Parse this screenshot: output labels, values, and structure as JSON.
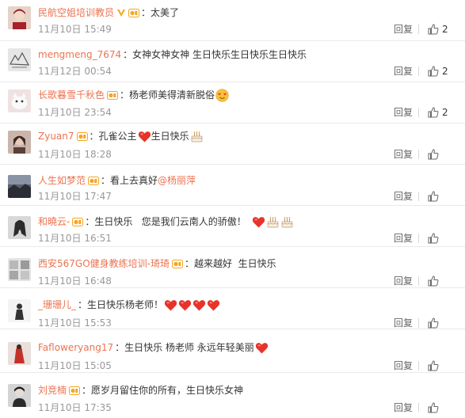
{
  "comments": [
    {
      "username": "民航空姐培训教员",
      "verified": true,
      "text": "太美了",
      "emoji": [],
      "time": "11月10日 15:49",
      "reply": "回复",
      "likes": "2",
      "avatar_bg": "#e7d2c8"
    },
    {
      "username": "mengmeng_7674",
      "verified": false,
      "badge": false,
      "text": "女神女神女神 生日快乐生日快乐生日快乐",
      "emoji": [],
      "time": "11月12日 00:54",
      "reply": "回复",
      "likes": "2",
      "avatar_bg": "#dcdcdc"
    },
    {
      "username": "长歌暮雪千秋色",
      "verified": false,
      "text": "杨老师美得清新脱俗",
      "emoji": [
        "love-face"
      ],
      "time": "11月10日 23:54",
      "reply": "回复",
      "likes": "2",
      "avatar_bg": "#f0dcdc"
    },
    {
      "username": "Zyuan7",
      "verified": false,
      "text": "孔雀公主",
      "text2": "生日快乐",
      "emoji": [
        "heart"
      ],
      "emoji2": [
        "cake"
      ],
      "time": "11月10日 18:28",
      "reply": "回复",
      "likes": "",
      "avatar_bg": "#b8a39a"
    },
    {
      "username": "人生如梦范",
      "verified": false,
      "text": "看上去真好",
      "mention": "@杨丽萍",
      "emoji": [],
      "time": "11月10日 17:47",
      "reply": "回复",
      "likes": "",
      "avatar_bg": "#4a4e56"
    },
    {
      "username": "和曉云-",
      "verified": false,
      "text": "生日快乐   您是我们云南人的骄傲！",
      "emoji": [
        "heart",
        "cake",
        "cake"
      ],
      "time": "11月10日 16:51",
      "reply": "回复",
      "likes": "",
      "avatar_bg": "#cfcfcf"
    },
    {
      "username": "西安567GO健身教练培训-琦琦",
      "verified": false,
      "text": "越来越好  生日快乐",
      "emoji": [],
      "time": "11月10日 16:48",
      "reply": "回复",
      "likes": "",
      "avatar_bg": "#d8d8d8"
    },
    {
      "username": "_珊珊儿_",
      "verified": false,
      "text": "生日快乐杨老师！",
      "emoji": [
        "heart",
        "heart",
        "heart",
        "heart"
      ],
      "time": "11月10日 15:53",
      "reply": "回复",
      "likes": "",
      "avatar_bg": "#ececec"
    },
    {
      "username": "Fafloweryang17",
      "verified": false,
      "text": "生日快乐 杨老师 永远年轻美丽",
      "emoji": [
        "heart"
      ],
      "time": "11月10日 15:05",
      "reply": "回复",
      "likes": "",
      "avatar_bg": "#c24a3a"
    },
    {
      "username": "刘竞楠",
      "verified": false,
      "text": "愿岁月留住你的所有，生日快乐女神",
      "emoji": [],
      "time": "11月10日 17:35",
      "reply": "回复",
      "likes": "",
      "avatar_bg": "#3a3a3a"
    }
  ],
  "colors": {
    "username": "#eb7350",
    "time": "#999999",
    "heart": "#e8332a",
    "badge": "#f5a623"
  },
  "icons": {
    "like": "thumbs-up-icon",
    "badge": "member-badge-icon",
    "verified": "verified-v-icon"
  }
}
